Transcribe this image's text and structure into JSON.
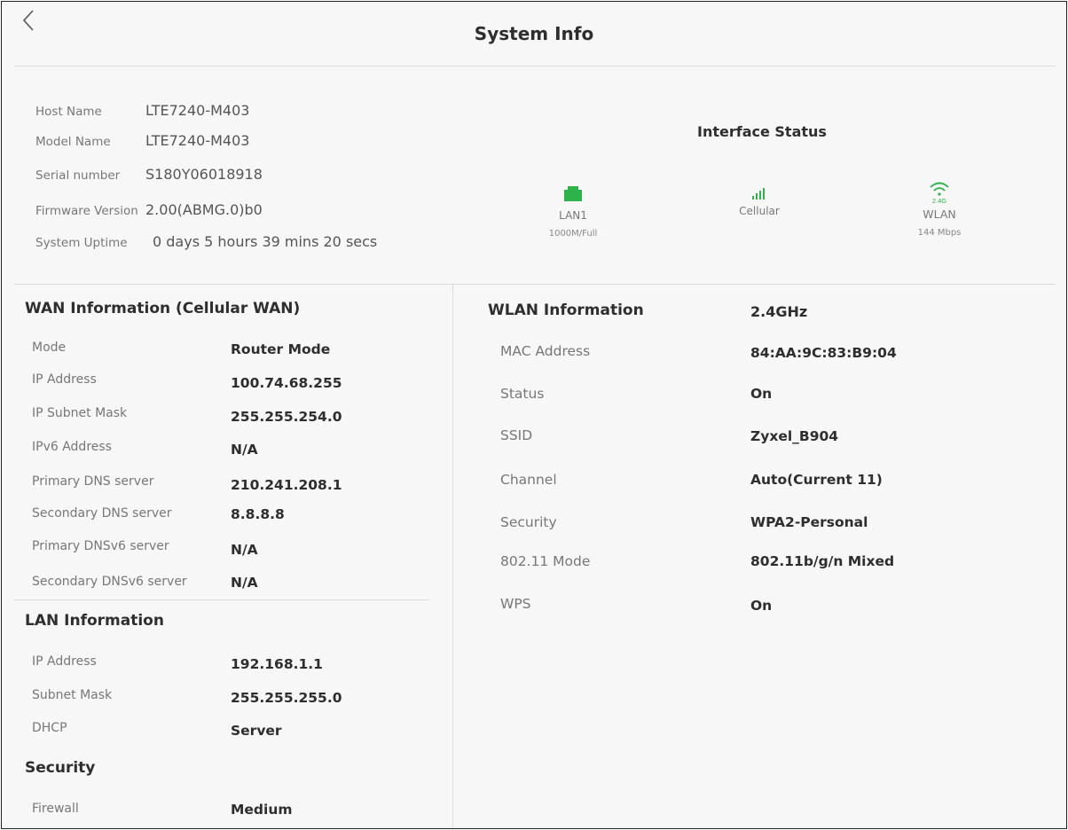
{
  "header": {
    "title": "System Info",
    "back_glyph": "‹"
  },
  "system": {
    "rows": [
      {
        "label": "Host Name",
        "value": "LTE7240-M403"
      },
      {
        "label": "Model Name",
        "value": "LTE7240-M403"
      },
      {
        "label": "Serial number",
        "value": "S180Y06018918"
      },
      {
        "label": "Firmware Version",
        "value": "2.00(ABMG.0)b0"
      },
      {
        "label": "System Uptime",
        "value": "0 days 5 hours 39 mins 20 secs"
      }
    ]
  },
  "interface_status": {
    "title": "Interface Status",
    "items": [
      {
        "name": "LAN1",
        "sub": "1000M/Full",
        "icon": "ethernet-port-icon",
        "color": "#2db34a"
      },
      {
        "name": "Cellular",
        "sub": "",
        "icon": "signal-bars-icon",
        "color": "#2db34a"
      },
      {
        "name": "WLAN",
        "sub": "144 Mbps",
        "icon": "wifi-icon",
        "icon_text": "2.4G",
        "color": "#2db34a"
      }
    ]
  },
  "wan": {
    "title": "WAN Information (Cellular WAN)",
    "rows": [
      {
        "label": "Mode",
        "value": "Router Mode"
      },
      {
        "label": "IP Address",
        "value": "100.74.68.255"
      },
      {
        "label": "IP Subnet Mask",
        "value": "255.255.254.0"
      },
      {
        "label": "IPv6 Address",
        "value": "N/A"
      },
      {
        "label": "Primary DNS server",
        "value": "210.241.208.1"
      },
      {
        "label": "Secondary DNS server",
        "value": "8.8.8.8"
      },
      {
        "label": "Primary DNSv6 server",
        "value": "N/A"
      },
      {
        "label": "Secondary DNSv6 server",
        "value": "N/A"
      }
    ]
  },
  "lan": {
    "title": "LAN Information",
    "rows": [
      {
        "label": "IP Address",
        "value": "192.168.1.1"
      },
      {
        "label": "Subnet Mask",
        "value": "255.255.255.0"
      },
      {
        "label": "DHCP",
        "value": "Server"
      }
    ]
  },
  "security": {
    "title": "Security",
    "rows": [
      {
        "label": "Firewall",
        "value": "Medium"
      }
    ]
  },
  "wlan": {
    "title": "WLAN Information",
    "band": "2.4GHz",
    "rows": [
      {
        "label": "MAC Address",
        "value": "84:AA:9C:83:B9:04"
      },
      {
        "label": "Status",
        "value": "On"
      },
      {
        "label": "SSID",
        "value": "Zyxel_B904"
      },
      {
        "label": "Channel",
        "value": "Auto(Current 11)"
      },
      {
        "label": "Security",
        "value": "WPA2-Personal"
      },
      {
        "label": "802.11 Mode",
        "value": "802.11b/g/n Mixed"
      },
      {
        "label": "WPS",
        "value": "On"
      }
    ]
  }
}
